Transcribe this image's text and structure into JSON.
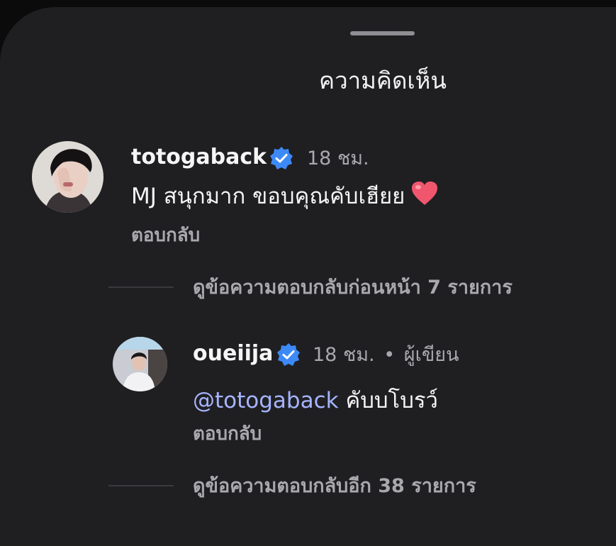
{
  "sheet": {
    "title": "ความคิดเห็น"
  },
  "comment": {
    "username": "totogaback",
    "time": "18 ชม.",
    "text": "MJ สนุกมาก ขอบคุณคับเฮียย",
    "emoji": "heart-icon",
    "reply_label": "ตอบกลับ"
  },
  "view_previous_replies": "ดูข้อความตอบกลับก่อนหน้า 7 รายการ",
  "reply": {
    "username": "oueiija",
    "time": "18 ชม.",
    "separator": "•",
    "author_badge": "ผู้เขียน",
    "mention": "@totogaback",
    "text": "คับบโบรว์",
    "reply_label": "ตอบกลับ"
  },
  "view_more_replies": "ดูข้อความตอบกลับอีก 38 รายการ",
  "colors": {
    "background": "#1f1f22",
    "verified_badge": "#3d8af7",
    "mention": "#a6b4ff",
    "heart": "#f0566e"
  }
}
